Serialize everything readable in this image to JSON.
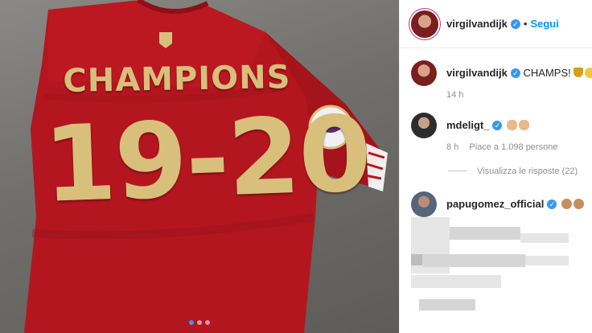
{
  "post": {
    "shirt": {
      "word": "CHAMPIONS",
      "number": "19-20"
    },
    "carousel_total": 3,
    "carousel_active": 1
  },
  "header": {
    "username": "virgilvandijk",
    "separator": "•",
    "follow_label": "Segui"
  },
  "caption": {
    "username": "virgilvandijk",
    "text": "CHAMPS!",
    "time": "14 h"
  },
  "comments": [
    {
      "username": "mdeligt_",
      "time": "8 h",
      "likes": "Piace a 1.098 persone",
      "replies_label": "Visualizza le risposte (22)"
    },
    {
      "username": "papugomez_official"
    }
  ],
  "colors": {
    "shirt_red": "#b3161f",
    "shirt_gold": "#d8bf7c",
    "link_blue": "#0095f6",
    "verified_blue": "#3897f0"
  },
  "icons": [
    "verified-badge-icon",
    "trophy-emoji-icon",
    "smile-emoji-icon",
    "clap-emoji-icon",
    "pray-emoji-icon"
  ]
}
